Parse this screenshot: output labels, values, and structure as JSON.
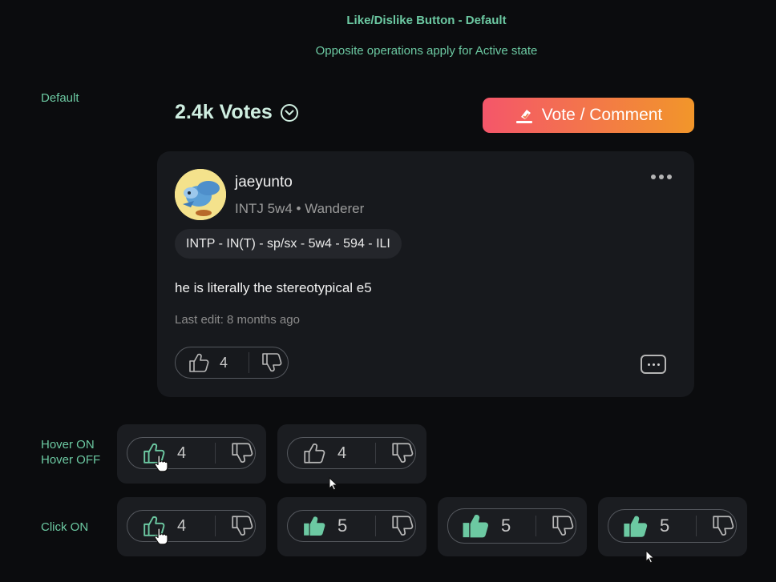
{
  "header": {
    "title": "Like/Dislike Button - Default",
    "subtitle": "Opposite operations apply for Active state"
  },
  "labels": {
    "default": "Default",
    "hover_on": "Hover ON",
    "hover_off": "Hover OFF",
    "click_on": "Click ON"
  },
  "votes": {
    "count": "2.4k Votes"
  },
  "vote_button": {
    "label": "Vote / Comment"
  },
  "post": {
    "username": "jaeyunto",
    "type": "INTJ 5w4",
    "separator": "•",
    "title": "Wanderer",
    "type_tag": "INTP - IN(T) - sp/sx - 5w4 - 594 - ILI",
    "comment": "he is literally the stereotypical e5",
    "last_edit": "Last edit: 8 months ago",
    "like_count": "4"
  },
  "states": {
    "hover_on_count": "4",
    "hover_off_count": "4",
    "click_1_count": "4",
    "click_2_count": "5",
    "click_3_count": "5",
    "click_4_count": "5"
  },
  "colors": {
    "accent_green": "#6cc9a2",
    "background": "#0b0c0e",
    "card": "#17191d",
    "gradient_start": "#f4566a",
    "gradient_end": "#f2962a"
  },
  "icons": [
    "thumb-up-icon",
    "thumb-down-icon",
    "chevron-down-icon",
    "ballot-icon",
    "more-icon",
    "comment-icon",
    "hand-pointer-icon",
    "arrow-pointer-icon"
  ]
}
